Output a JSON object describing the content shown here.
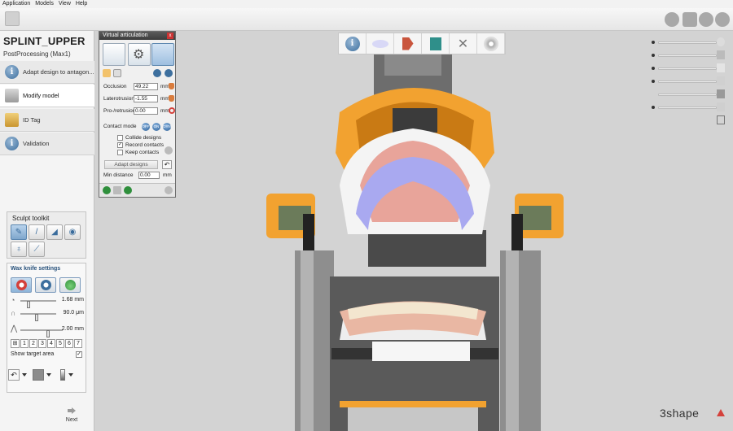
{
  "menu": [
    "Application",
    "Models",
    "View",
    "Help"
  ],
  "project": {
    "title": "SPLINT_UPPER",
    "subtitle": "PostProcessing (Max1)"
  },
  "steps": [
    {
      "label": "Adapt design to antagon...",
      "icon": "info-icon"
    },
    {
      "label": "Modify model",
      "icon": "modify-model-icon"
    },
    {
      "label": "ID Tag",
      "icon": "id-tag-icon"
    },
    {
      "label": "Validation",
      "icon": "info-icon"
    }
  ],
  "sculpt": {
    "title": "Sculpt toolkit"
  },
  "wax": {
    "title": "Wax knife settings",
    "size_value": "1.68 mm",
    "thickness_value": "90.0 μm",
    "depth_value": "2.00 mm",
    "numbers": [
      "1",
      "2",
      "3",
      "4",
      "5",
      "6",
      "7"
    ],
    "show_target_label": "Show target area",
    "show_target_checked": "✓"
  },
  "next_label": "Next",
  "va": {
    "title": "Virtual articulation",
    "close": "x",
    "occlusion_label": "Occlusion",
    "occlusion_value": "49.22",
    "laterotrusion_label": "Laterotrusion",
    "laterotrusion_value": "-1.55",
    "protrusion_label": "Pro-/retrusion",
    "protrusion_value": "0.00",
    "unit": "mm",
    "contact_mode_label": "Contact mode",
    "contact_modes": [
      "OFF",
      "ON",
      "DYN"
    ],
    "collide_label": "Collide designs",
    "record_label": "Record contacts",
    "record_checked": "✓",
    "keep_label": "Keep contacts",
    "adapt_label": "Adapt designs",
    "min_distance_label": "Min distance",
    "min_distance_value": "0.00"
  },
  "logo": "3shape",
  "colors": {
    "articulator_orange": "#f2a230",
    "splint_purple": "#a9a9f0",
    "gum_pink": "#e8a49a",
    "tooth_ivory": "#f3e6cf",
    "accent_blue": "#3d6f9e",
    "logo_red": "#d4413b"
  }
}
